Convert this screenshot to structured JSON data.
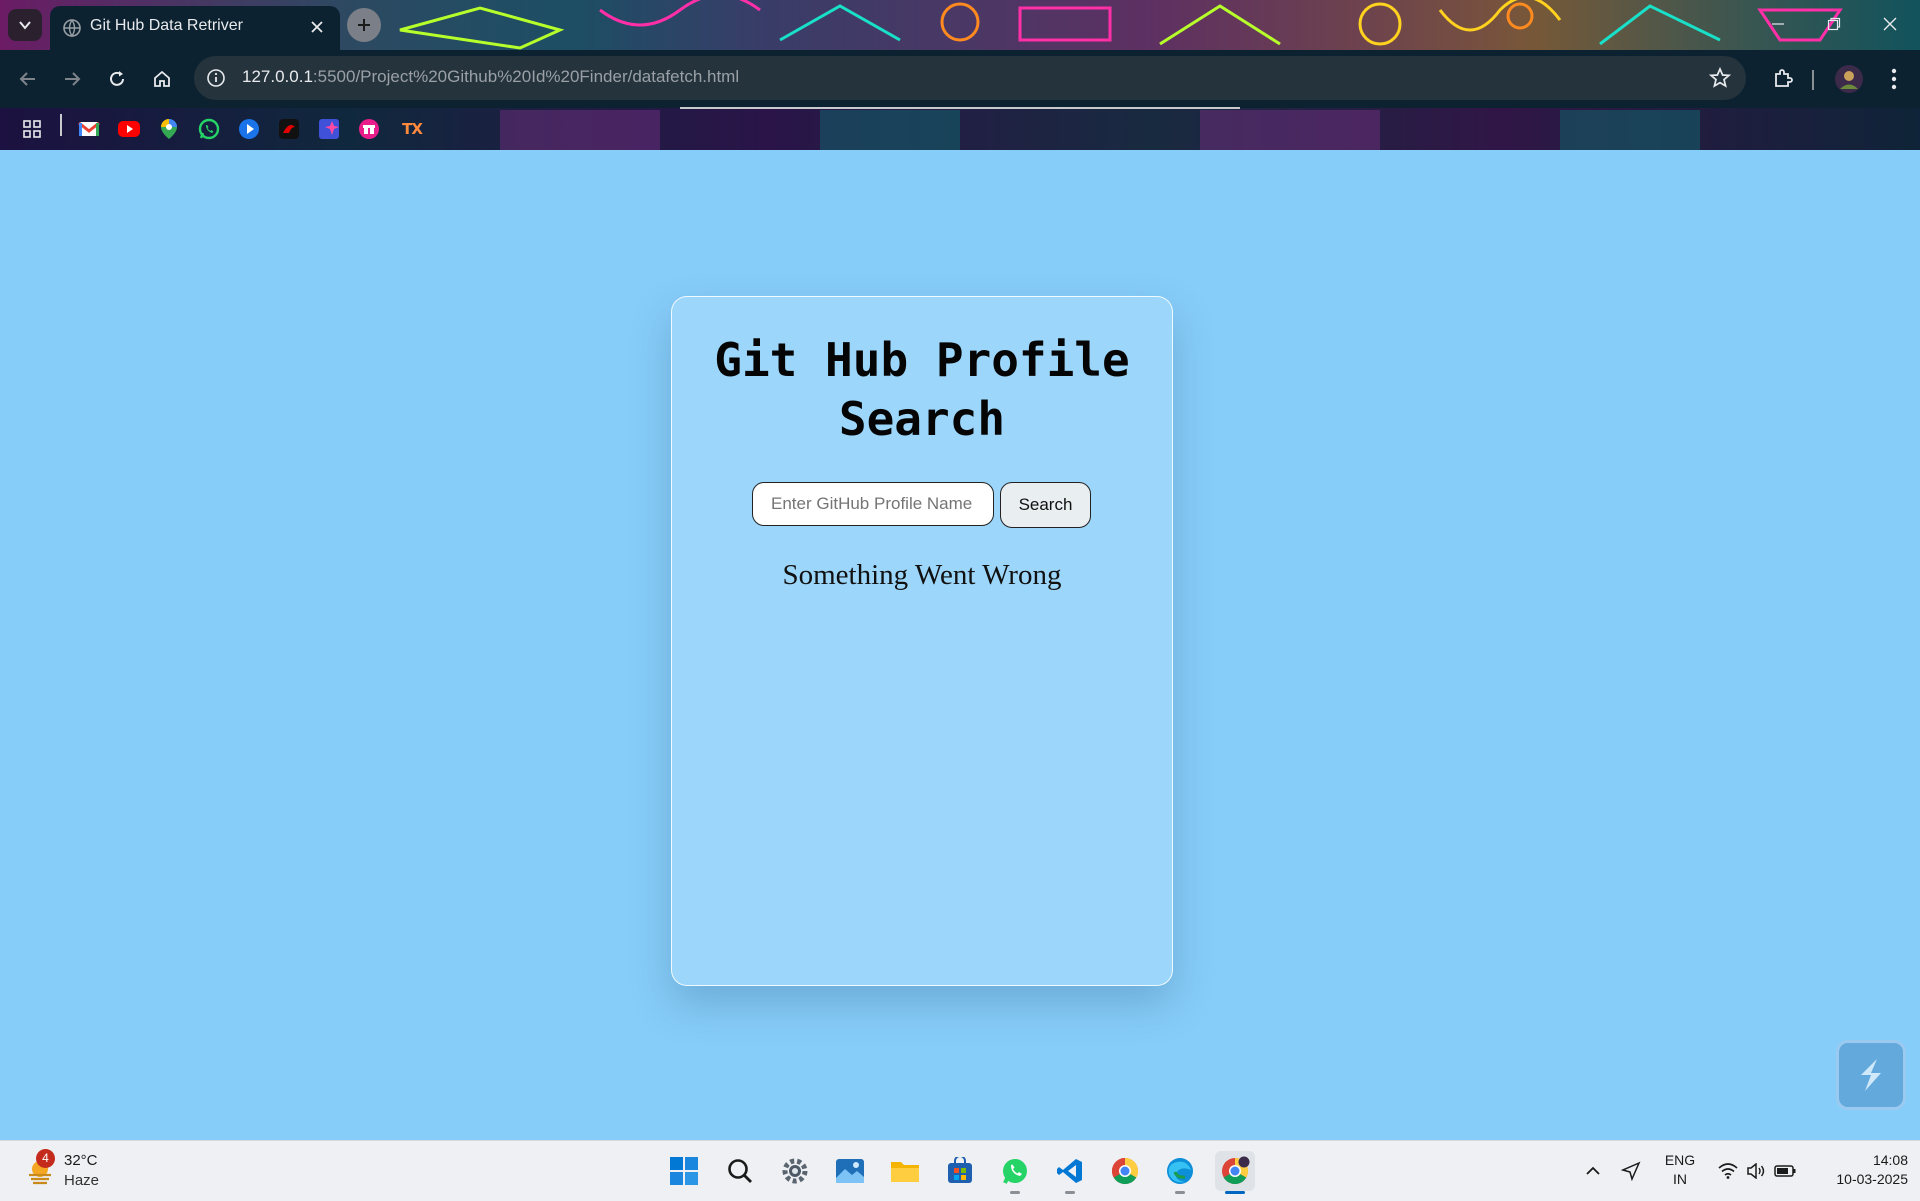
{
  "browser": {
    "tab_title": "Git Hub Data Retriver",
    "url_host": "127.0.0.1",
    "url_rest": ":5500/Project%20Github%20Id%20Finder/datafetch.html",
    "bookmarks": [
      "apps-icon",
      "gmail-icon",
      "youtube-icon",
      "maps-icon",
      "whatsapp-icon",
      "play-icon",
      "airtel-icon",
      "pinterest-icon",
      "gift-icon",
      "tx-icon"
    ],
    "bookmark_tx_label": "TX"
  },
  "page": {
    "heading_line1": "Git Hub Profile",
    "heading_line2": "Search",
    "search": {
      "placeholder": "Enter GitHub Profile Name",
      "value": "",
      "button_label": "Search"
    },
    "message": "Something Went Wrong"
  },
  "taskbar": {
    "weather": {
      "temp": "32°C",
      "condition": "Haze",
      "badge": "4"
    },
    "apps": [
      "windows-start-icon",
      "search-icon",
      "settings-icon",
      "photos-icon",
      "file-explorer-icon",
      "store-icon",
      "whatsapp-icon",
      "vscode-icon",
      "chrome-icon",
      "edge-icon",
      "chrome-profile-icon"
    ],
    "language_line1": "ENG",
    "language_line2": "IN",
    "time": "14:08",
    "date": "10-03-2025"
  },
  "colors": {
    "page_background": "#87cdf9",
    "chrome_toolbar": "#0d2230",
    "taskbar": "#eef0f3"
  }
}
